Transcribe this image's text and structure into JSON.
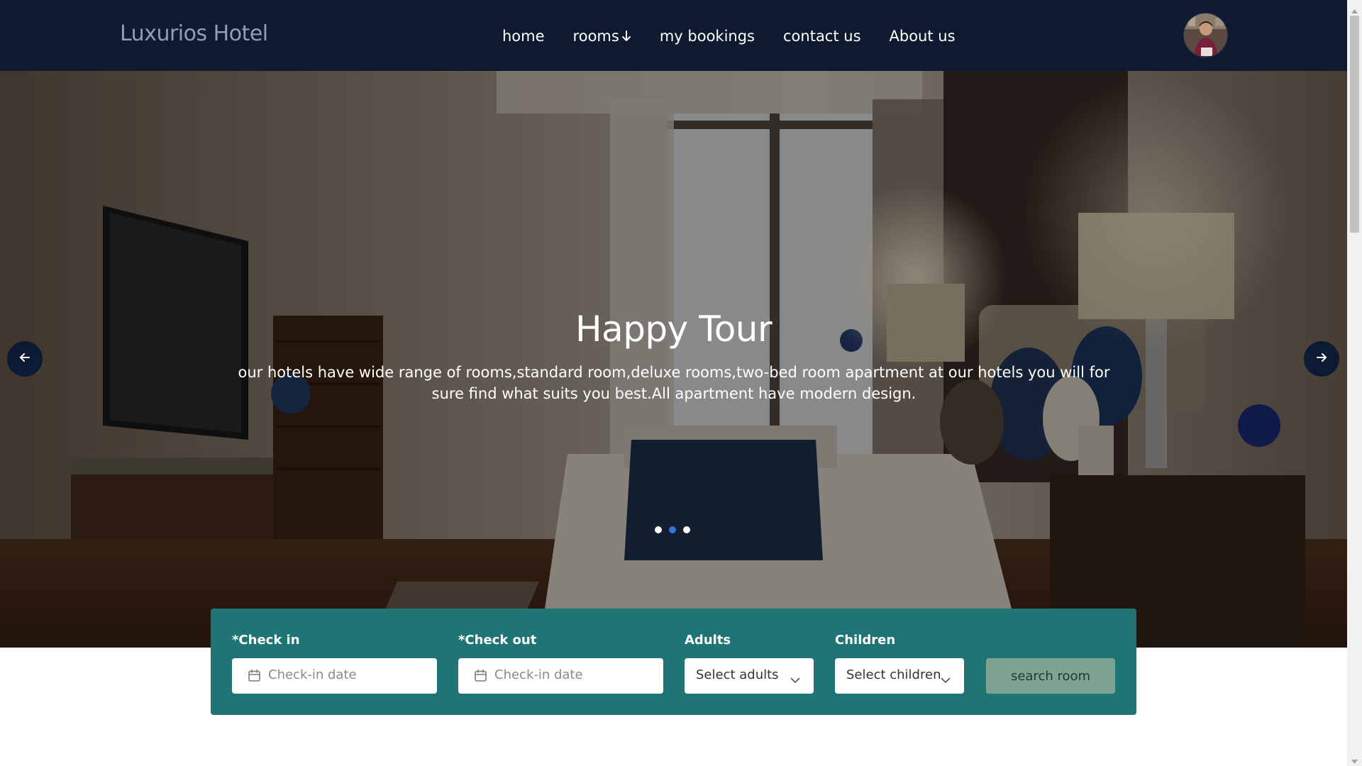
{
  "header": {
    "brand": "Luxurios Hotel",
    "nav": [
      "home",
      "rooms",
      "my bookings",
      "contact us",
      "About us"
    ]
  },
  "hero": {
    "title": "Happy Tour",
    "description": "our hotels have wide range of rooms,standard room,deluxe rooms,two-bed room apartment at our hotels you will for sure find what suits you best.All apartment have modern design.",
    "slide_count": 3,
    "active_slide": 2
  },
  "booking": {
    "check_in_label": "*Check in",
    "check_in_placeholder": "Check-in date",
    "check_out_label": "*Check out",
    "check_out_placeholder": "Check-in date",
    "adults_label": "Adults",
    "adults_value": "Select adults",
    "children_label": "Children",
    "children_value": "Select children",
    "search_label": "search room"
  },
  "icons": {
    "rooms_dropdown": "arrow-down-icon",
    "prev": "arrow-left-icon",
    "next": "arrow-right-icon",
    "date": "calendar-icon",
    "select": "chevron-down-icon"
  },
  "colors": {
    "navbar": "#0f1a30",
    "brand_text": "#8fa0b2",
    "booking_panel": "#1f7476",
    "search_button": "#7ea390",
    "active_dot": "#3b6fe0"
  }
}
